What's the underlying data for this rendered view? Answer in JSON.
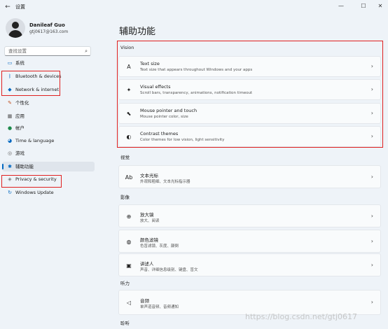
{
  "window": {
    "back_glyph": "←",
    "title": "设置",
    "controls": {
      "minimize": "—",
      "maximize": "☐",
      "close": "✕"
    }
  },
  "profile": {
    "name": "Danileaf Guo",
    "email": "gtj0617@163.com"
  },
  "search": {
    "placeholder": "查找设置",
    "icon_glyph": "⌕"
  },
  "sidebar": {
    "items": [
      {
        "label": "系统",
        "icon": "monitor-icon",
        "glyph": "▭",
        "color": "#0067c0"
      },
      {
        "label": "Bluetooth & devices",
        "icon": "bluetooth-icon",
        "glyph": "ᛒ",
        "color": "#0067c0"
      },
      {
        "label": "Network & internet",
        "icon": "wifi-icon",
        "glyph": "◆",
        "color": "#0067c0"
      },
      {
        "label": "个性化",
        "icon": "pen-icon",
        "glyph": "✎",
        "color": "#c0501f"
      },
      {
        "label": "应用",
        "icon": "apps-icon",
        "glyph": "▦",
        "color": "#555555"
      },
      {
        "label": "帐户",
        "icon": "person-icon",
        "glyph": "●",
        "color": "#1e8a4c"
      },
      {
        "label": "Time & language",
        "icon": "globe-icon",
        "glyph": "◕",
        "color": "#0067c0"
      },
      {
        "label": "游戏",
        "icon": "gamepad-icon",
        "glyph": "◎",
        "color": "#666666"
      },
      {
        "label": "辅助功能",
        "icon": "accessibility-icon",
        "glyph": "✱",
        "color": "#0067c0"
      },
      {
        "label": "Privacy & security",
        "icon": "shield-icon",
        "glyph": "◈",
        "color": "#777777"
      },
      {
        "label": "Windows Update",
        "icon": "update-icon",
        "glyph": "↻",
        "color": "#0067c0"
      }
    ],
    "active_index": 8
  },
  "main": {
    "title": "辅助功能",
    "sections": [
      {
        "title": "Vision",
        "cards": [
          {
            "title": "Text size",
            "subtitle": "Text size that appears throughout Windows and your apps",
            "icon": "text-size-icon",
            "glyph": "A"
          },
          {
            "title": "Visual effects",
            "subtitle": "Scroll bars, transparency, animations, notification timeout",
            "icon": "sparkle-icon",
            "glyph": "✦"
          },
          {
            "title": "Mouse pointer and touch",
            "subtitle": "Mouse pointer color, size",
            "icon": "pointer-icon",
            "glyph": "⬉"
          },
          {
            "title": "Contrast themes",
            "subtitle": "Color themes for low vision, light sensitivity",
            "icon": "contrast-icon",
            "glyph": "◐"
          }
        ]
      },
      {
        "title": "视觉",
        "cards": [
          {
            "title": "文本光标",
            "subtitle": "外观和粗细、文本光标指示器",
            "icon": "text-cursor-icon",
            "glyph": "Ab"
          }
        ]
      },
      {
        "title": "影像",
        "cards": [
          {
            "title": "放大镜",
            "subtitle": "放大、阅读",
            "icon": "magnifier-icon",
            "glyph": "⊕"
          },
          {
            "title": "颜色滤镜",
            "subtitle": "色盲滤镜、灰度、颠倒",
            "icon": "color-filter-icon",
            "glyph": "◍"
          },
          {
            "title": "讲述人",
            "subtitle": "声音、详细信息级别、键盘、盲文",
            "icon": "narrator-icon",
            "glyph": "▣"
          }
        ]
      },
      {
        "title": "听力",
        "cards": [
          {
            "title": "音频",
            "subtitle": "单声道音频、音频通知",
            "icon": "speaker-icon",
            "glyph": "◁"
          }
        ]
      },
      {
        "title": "聆听",
        "cards": []
      }
    ]
  },
  "chevron_glyph": "›",
  "watermark": "https://blog.csdn.net/gtj0617",
  "accent_color": "#0067c0",
  "highlight_color": "#e02020"
}
